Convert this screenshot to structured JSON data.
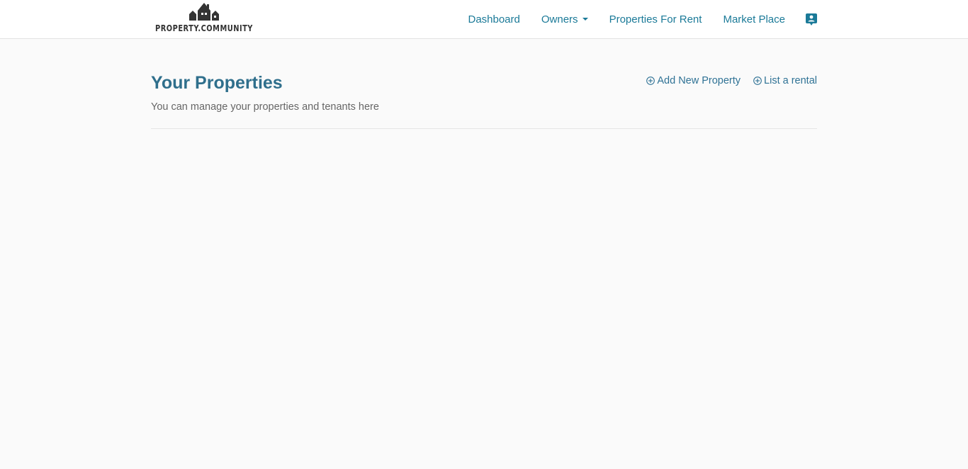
{
  "brand": {
    "name": "PROPERTY.COMMUNITY"
  },
  "nav": {
    "items": [
      {
        "label": "Dashboard"
      },
      {
        "label": "Owners",
        "has_dropdown": true
      },
      {
        "label": "Properties For Rent"
      },
      {
        "label": "Market Place"
      }
    ],
    "profile_icon": "account-box-icon"
  },
  "page": {
    "title": "Your Properties",
    "subtitle": "You can manage your properties and tenants here",
    "actions": [
      {
        "label": "Add New Property",
        "icon": "plus-circle-icon"
      },
      {
        "label": "List a rental",
        "icon": "plus-circle-icon"
      }
    ]
  },
  "colors": {
    "link": "#1b7a98",
    "title": "#2f6f8c",
    "background": "#fafafa"
  }
}
